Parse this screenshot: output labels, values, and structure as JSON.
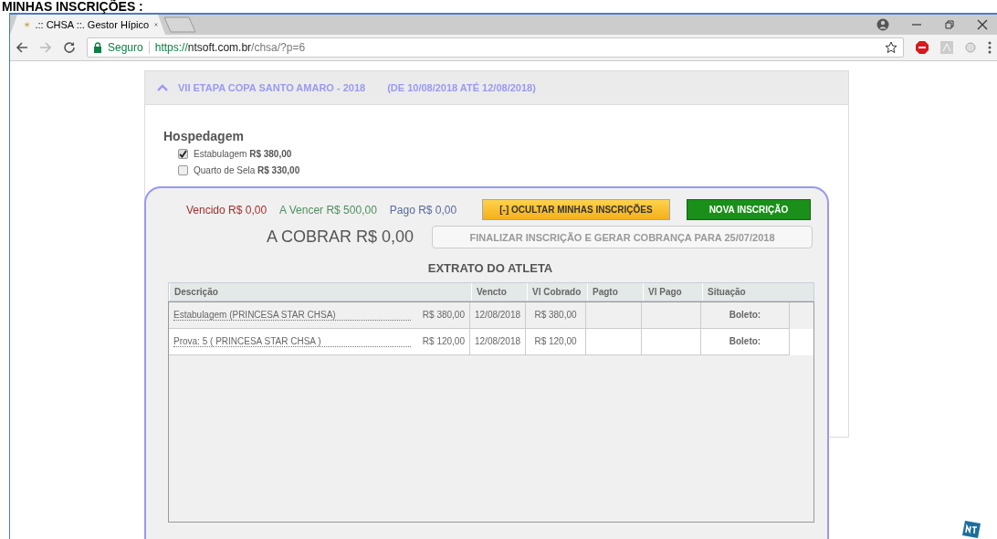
{
  "heading": "MINHAS INSCRIÇÕES :",
  "browser": {
    "tab_title": ".:: CHSA ::. Gestor Hípico",
    "secure_label": "Seguro",
    "url_scheme": "https://",
    "url_host": "ntsoft.com.br",
    "url_path": "/chsa/?p=6"
  },
  "event": {
    "expanded": true,
    "title": "VII ETAPA COPA SANTO AMARO - 2018",
    "dates": "(DE 10/08/2018 ATÉ 12/08/2018)",
    "section": "Hospedagem",
    "options": [
      {
        "label": "Estabulagem",
        "price": "R$ 380,00",
        "checked": true
      },
      {
        "label": "Quarto de Sela",
        "price": "R$ 330,00",
        "checked": false
      }
    ]
  },
  "summary": {
    "totals": [
      {
        "kind": "overdue",
        "text": "Vencido R$ 0,00"
      },
      {
        "kind": "due",
        "text": "A Vencer R$ 500,00"
      },
      {
        "kind": "paid",
        "text": "Pago R$ 0,00"
      }
    ],
    "hide_button": "[-] OCULTAR MINHAS INSCRIÇÕES",
    "new_button": "NOVA INSCRIÇÃO",
    "to_charge": "A COBRAR R$ 0,00",
    "finalize_button": {
      "label": "FINALIZAR INSCRIÇÃO E GERAR COBRANÇA PARA 25/07/2018",
      "disabled": true
    }
  },
  "statement": {
    "title": "EXTRATO DO ATLETA",
    "columns": [
      "Descrição",
      "Vencto",
      "Vl Cobrado",
      "Pagto",
      "Vl Pago",
      "Situação"
    ],
    "rows": [
      {
        "description": "Estabulagem (PRINCESA STAR CHSA)",
        "amount": "R$ 380,00",
        "vencto": "12/08/2018",
        "vl_cobrado": "R$ 380,00",
        "situacao": "Boleto:"
      },
      {
        "description": "Prova: 5 ( PRINCESA STAR CHSA )",
        "amount": "R$ 120,00",
        "vencto": "12/08/2018",
        "vl_cobrado": "R$ 120,00",
        "situacao": "Boleto:"
      }
    ]
  }
}
